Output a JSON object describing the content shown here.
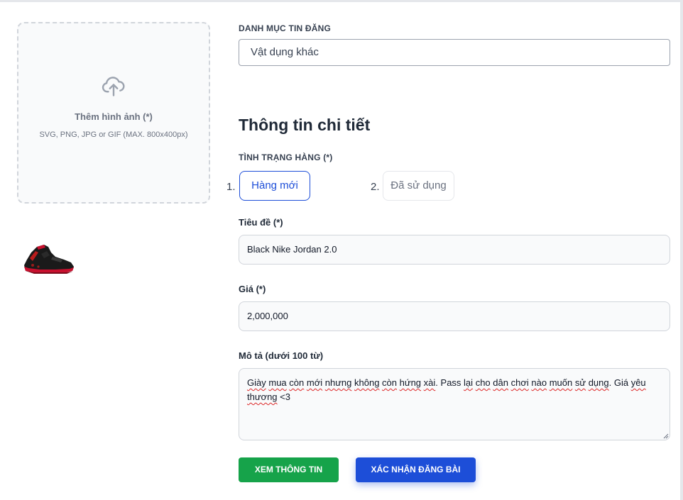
{
  "upload": {
    "title": "Thêm hình ảnh (*)",
    "hint": "SVG, PNG, JPG or GIF (MAX. 800x400px)",
    "icon": "cloud-upload-icon"
  },
  "thumbnail": {
    "alt": "product-photo-sneaker"
  },
  "category": {
    "label": "DANH MỤC TIN ĐĂNG",
    "value": "Vật dụng khác"
  },
  "details": {
    "title": "Thông tin chi tiết",
    "condition": {
      "label": "TÌNH TRẠNG HÀNG (*)",
      "options": [
        {
          "num": "1.",
          "label": "Hàng mới",
          "selected": true
        },
        {
          "num": "2.",
          "label": "Đã sử dụng",
          "selected": false
        }
      ]
    },
    "title_field": {
      "label": "Tiêu đề (*)",
      "value": "Black Nike Jordan 2.0"
    },
    "price_field": {
      "label": "Giá (*)",
      "value": "2,000,000"
    },
    "description": {
      "label": "Mô tả (dưới 100 từ)",
      "words": [
        "Giày",
        " ",
        "mua",
        " ",
        "còn",
        " ",
        "mới",
        " ",
        "nhưng",
        " ",
        "không",
        " ",
        "còn",
        " ",
        "hứng",
        " ",
        "xài",
        ". Pass ",
        "lại",
        " ",
        "cho",
        " ",
        "dân",
        " ",
        "chơi",
        " ",
        "nào",
        " ",
        "muốn",
        " ",
        "sử",
        " ",
        "dụng",
        ". Giá ",
        "yêu",
        " ",
        "thương",
        " <3"
      ]
    }
  },
  "actions": {
    "view_label": "XEM THÔNG TIN",
    "submit_label": "XÁC NHẬN ĐĂNG BÀI"
  },
  "colors": {
    "primary": "#1d4ed8",
    "success": "#16a34a",
    "field_bg": "#f9fafb",
    "spellcheck": "#dc2626"
  }
}
